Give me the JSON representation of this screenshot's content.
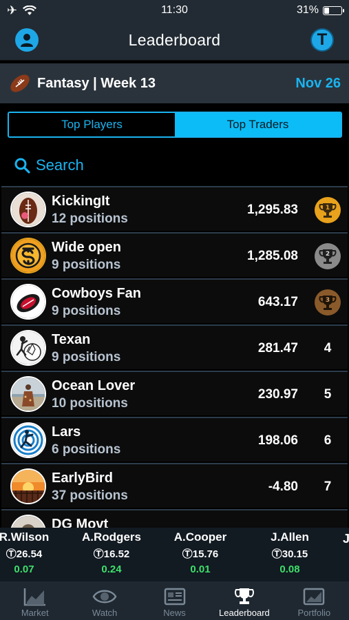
{
  "status_bar": {
    "time": "11:30",
    "battery": "31%",
    "battery_level": 0.31
  },
  "nav": {
    "title": "Leaderboard",
    "token_letter": "T"
  },
  "league": {
    "title": "Fantasy | Week 13",
    "date": "Nov 26"
  },
  "segment": {
    "top_players": "Top Players",
    "top_traders": "Top Traders",
    "selected": "Top Traders"
  },
  "search": {
    "label": "Search"
  },
  "leaderboard": [
    {
      "name": "KickingIt",
      "positions": "12 positions",
      "score": "1,295.83",
      "rank": "1",
      "trophy": "gold"
    },
    {
      "name": "Wide open",
      "positions": "9 positions",
      "score": "1,285.08",
      "rank": "2",
      "trophy": "silver"
    },
    {
      "name": "Cowboys Fan",
      "positions": "9 positions",
      "score": "643.17",
      "rank": "3",
      "trophy": "bronze"
    },
    {
      "name": "Texan",
      "positions": "9 positions",
      "score": "281.47",
      "rank": "4"
    },
    {
      "name": "Ocean Lover",
      "positions": "10 positions",
      "score": "230.97",
      "rank": "5"
    },
    {
      "name": "Lars",
      "positions": "6 positions",
      "score": "198.06",
      "rank": "6"
    },
    {
      "name": "EarlyBird",
      "positions": "37 positions",
      "score": "-4.80",
      "rank": "7"
    },
    {
      "name": "DG Movt",
      "positions": "",
      "score": "",
      "rank": ""
    }
  ],
  "ticker": [
    {
      "name": "R.Wilson",
      "price": "26.54",
      "change": "0.07"
    },
    {
      "name": "A.Rodgers",
      "price": "16.52",
      "change": "0.24"
    },
    {
      "name": "A.Cooper",
      "price": "15.76",
      "change": "0.01"
    },
    {
      "name": "J.Allen",
      "price": "30.15",
      "change": "0.08"
    }
  ],
  "tabs": [
    {
      "label": "Market",
      "icon": "chart-icon"
    },
    {
      "label": "Watch",
      "icon": "eye-icon"
    },
    {
      "label": "News",
      "icon": "newspaper-icon"
    },
    {
      "label": "Leaderboard",
      "icon": "trophy-icon",
      "active": true
    },
    {
      "label": "Portfolio",
      "icon": "portfolio-icon"
    }
  ],
  "colors": {
    "accent": "#1ab4f0",
    "positive": "#3ee06a",
    "gold": "#e8a21c",
    "silver": "#8a8a8a",
    "bronze": "#8a5a2a"
  }
}
